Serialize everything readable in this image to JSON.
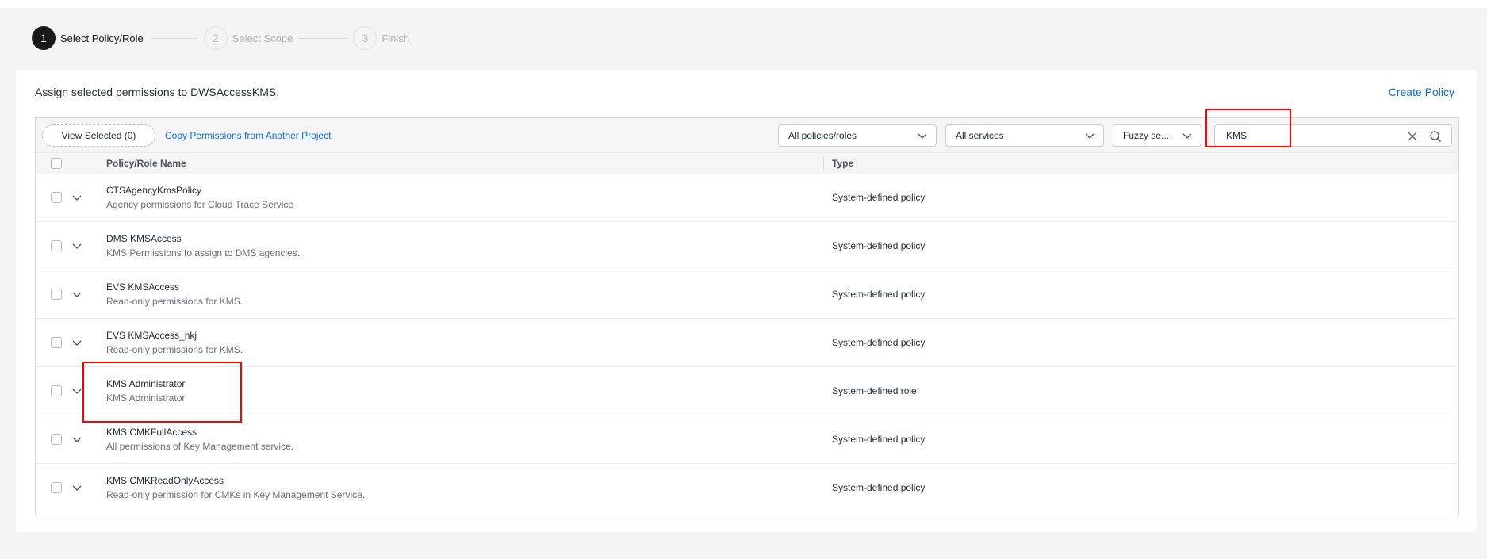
{
  "steps": [
    {
      "number": "1",
      "label": "Select Policy/Role"
    },
    {
      "number": "2",
      "label": "Select Scope"
    },
    {
      "number": "3",
      "label": "Finish"
    }
  ],
  "assign_text": "Assign selected permissions to DWSAccessKMS.",
  "create_policy": "Create Policy",
  "toolbar": {
    "view_selected": "View Selected (0)",
    "copy_permissions": "Copy Permissions from Another Project",
    "policy_filter": "All policies/roles",
    "service_filter": "All services",
    "search_mode": "Fuzzy se...",
    "search_value": "KMS"
  },
  "table": {
    "columns": {
      "name": "Policy/Role Name",
      "type": "Type"
    },
    "rows": [
      {
        "name": "CTSAgencyKmsPolicy",
        "desc": "Agency permissions for Cloud Trace Service",
        "type": "System-defined policy"
      },
      {
        "name": "DMS KMSAccess",
        "desc": "KMS Permissions to assign to DMS agencies.",
        "type": "System-defined policy"
      },
      {
        "name": "EVS KMSAccess",
        "desc": "Read-only permissions for KMS.",
        "type": "System-defined policy"
      },
      {
        "name": "EVS KMSAccess_nkj",
        "desc": "Read-only permissions for KMS.",
        "type": "System-defined policy"
      },
      {
        "name": "KMS Administrator",
        "desc": "KMS Administrator",
        "type": "System-defined role"
      },
      {
        "name": "KMS CMKFullAccess",
        "desc": "All permissions of Key Management service.",
        "type": "System-defined policy"
      },
      {
        "name": "KMS CMKReadOnlyAccess",
        "desc": "Read-only permission for CMKs in Key Management Service.",
        "type": "System-defined policy"
      }
    ]
  },
  "colors": {
    "accent": "#0b6ee8",
    "highlight": "#ff0000",
    "active_step": "#191919"
  }
}
